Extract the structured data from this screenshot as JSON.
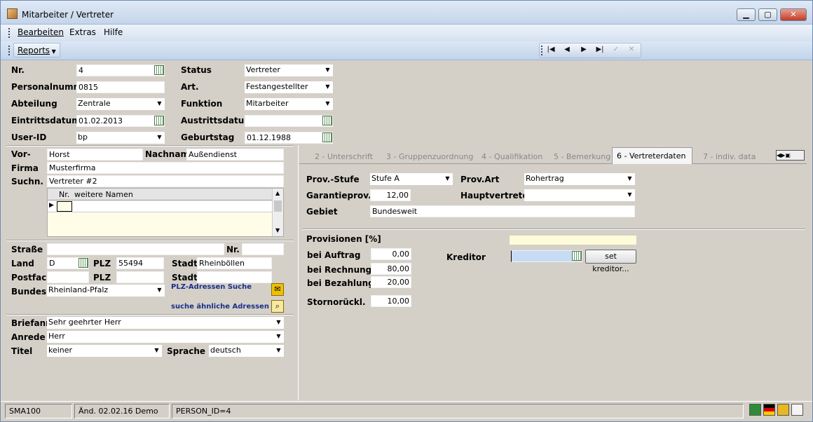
{
  "window": {
    "title": "Mitarbeiter / Vertreter"
  },
  "menu": {
    "items": [
      "Bearbeiten",
      "Extras",
      "Hilfe"
    ],
    "reports": "Reports"
  },
  "nav": {
    "first": "|◀",
    "prev": "◀",
    "next": "▶",
    "last": "▶|",
    "confirm": "✓",
    "cancel": "✕"
  },
  "form": {
    "nr_label": "Nr.",
    "nr_value": "4",
    "personalnummer_label": "Personalnummer",
    "personalnummer_value": "0815",
    "abteilung_label": "Abteilung",
    "abteilung_value": "Zentrale",
    "eintritt_label": "Eintrittsdatum",
    "eintritt_value": "01.02.2013",
    "userid_label": "User-ID",
    "userid_value": "bp",
    "status_label": "Status",
    "status_value": "Vertreter",
    "art_label": "Art.",
    "art_value": "Festangestellter",
    "funktion_label": "Funktion",
    "funktion_value": "Mitarbeiter",
    "austritt_label": "Austrittsdatum",
    "austritt_value": "",
    "geburtstag_label": "Geburtstag",
    "geburtstag_value": "01.12.1988"
  },
  "person": {
    "vor_label": "Vor-",
    "vor_value": "Horst",
    "nachname_label": "Nachname",
    "nachname_value": "Außendienst",
    "firma_label": "Firma",
    "firma_value": "Musterfirma",
    "suchn_label": "Suchn.",
    "suchn_value": "Vertreter #2",
    "names_col_nr": "Nr.",
    "names_col_name": "weitere Namen"
  },
  "address": {
    "strasse_label": "Straße",
    "strasse_value": "",
    "nr_label": "Nr.",
    "nr_value": "",
    "land_label": "Land",
    "land_value": "D",
    "plz_label": "PLZ",
    "plz_value": "55494",
    "stadt_label": "Stadt",
    "stadt_value": "Rheinböllen",
    "postfach_label": "Postfach",
    "postfach_value": "",
    "plz2_label": "PLZ",
    "plz2_value": "",
    "stadt2_label": "Stadt",
    "stadt2_value": "",
    "bundesl_label": "Bundesl.",
    "bundesl_value": "Rheinland-Pfalz",
    "plz_search_link": "PLZ-Adressen Suche",
    "similar_link": "suche ähnliche Adressen"
  },
  "letter": {
    "briefanr_label": "Briefanr.",
    "briefanr_value": "Sehr geehrter Herr",
    "anrede_label": "Anrede",
    "anrede_value": "Herr",
    "titel_label": "Titel",
    "titel_value": "keiner",
    "sprache_label": "Sprache",
    "sprache_value": "deutsch"
  },
  "tabs": [
    {
      "label": "2 - Unterschrift"
    },
    {
      "label": "3 - Gruppenzuordnung"
    },
    {
      "label": "4 - Qualifikation"
    },
    {
      "label": "5 - Bemerkung"
    },
    {
      "label": "6 - Vertreterdaten"
    },
    {
      "label": "7 - indiv. data"
    }
  ],
  "vertreter": {
    "provstufe_label": "Prov.-Stufe",
    "provstufe_value": "Stufe A",
    "provart_label": "Prov.Art",
    "provart_value": "Rohertrag",
    "garantie_label": "Garantieprov.",
    "garantie_value": "12,00",
    "hauptvertreter_label": "Hauptvertreter",
    "hauptvertreter_value": "",
    "gebiet_label": "Gebiet",
    "gebiet_value": "Bundesweit",
    "provisionen_label": "Provisionen [%]",
    "auftrag_label": "bei Auftrag",
    "auftrag_value": "0,00",
    "rechnung_label": "bei Rechnung",
    "rechnung_value": "80,00",
    "bezahlung_label": "bei Bezahlung",
    "bezahlung_value": "20,00",
    "storno_label": "Stornorückl.",
    "storno_value": "10,00",
    "kreditor_label": "Kreditor",
    "kreditor_value": "",
    "set_kreditor": "set kreditor..."
  },
  "status": {
    "code": "SMA100",
    "changed": "Änd. 02.02.16 Demo",
    "record": "PERSON_ID=4"
  }
}
